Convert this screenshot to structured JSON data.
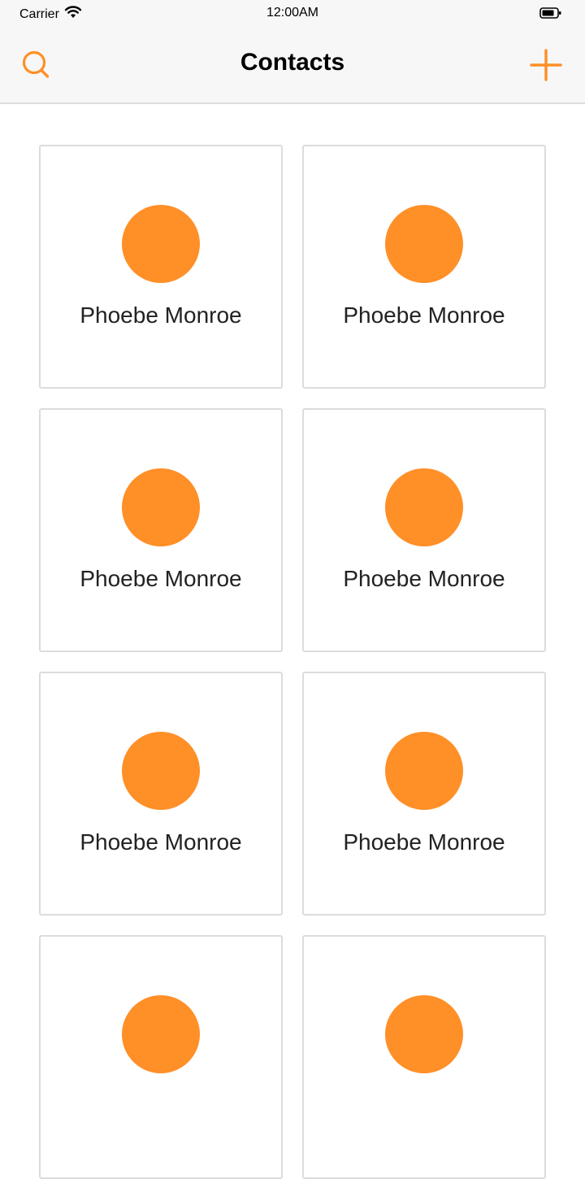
{
  "status_bar": {
    "carrier": "Carrier",
    "time": "12:00AM",
    "wifi_icon": "wifi-icon",
    "battery_icon": "battery-icon"
  },
  "nav": {
    "title": "Contacts",
    "search_icon": "search-icon",
    "add_icon": "plus-icon"
  },
  "colors": {
    "accent": "#ff8f27",
    "bar_background": "#f7f7f7",
    "card_border": "#dcdcdc"
  },
  "contacts": [
    {
      "name": "Phoebe Monroe"
    },
    {
      "name": "Phoebe Monroe"
    },
    {
      "name": "Phoebe Monroe"
    },
    {
      "name": "Phoebe Monroe"
    },
    {
      "name": "Phoebe Monroe"
    },
    {
      "name": "Phoebe Monroe"
    },
    {
      "name": ""
    },
    {
      "name": ""
    }
  ]
}
